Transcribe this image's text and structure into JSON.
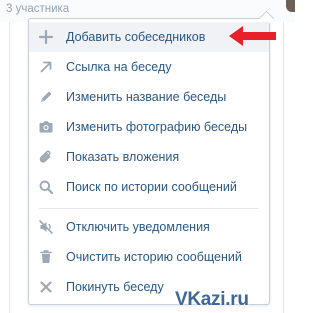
{
  "background": {
    "subtitle": "3 участника"
  },
  "menu": {
    "items": [
      {
        "label": "Добавить собеседников",
        "icon": "plus-icon"
      },
      {
        "label": "Ссылка на беседу",
        "icon": "link-arrow-icon"
      },
      {
        "label": "Изменить название беседы",
        "icon": "pencil-icon"
      },
      {
        "label": "Изменить фотографию беседы",
        "icon": "camera-icon"
      },
      {
        "label": "Показать вложения",
        "icon": "paperclip-icon"
      },
      {
        "label": "Поиск по истории сообщений",
        "icon": "search-icon"
      },
      {
        "label": "Отключить уведомления",
        "icon": "mute-icon"
      },
      {
        "label": "Очистить историю сообщений",
        "icon": "trash-icon"
      },
      {
        "label": "Покинуть беседу",
        "icon": "close-icon"
      }
    ]
  },
  "watermark": {
    "text": "VKazi.ru"
  },
  "colors": {
    "label": "#2a5885",
    "icon": "#9aa8b8",
    "hover": "#f0f2f5",
    "border": "#c5d0db",
    "arrow": "#e8202a",
    "watermark": "#3f6797"
  }
}
